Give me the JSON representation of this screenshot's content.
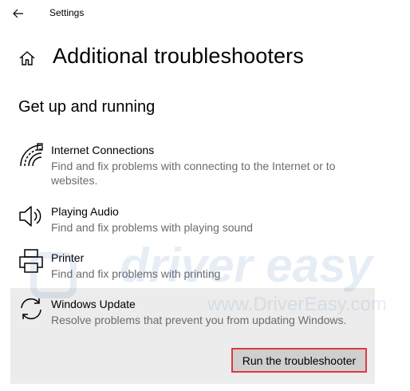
{
  "window": {
    "title": "Settings"
  },
  "page": {
    "title": "Additional troubleshooters",
    "section_title": "Get up and running"
  },
  "items": [
    {
      "icon": "wifi-icon",
      "name": "Internet Connections",
      "description": "Find and fix problems with connecting to the Internet or to websites."
    },
    {
      "icon": "speaker-icon",
      "name": "Playing Audio",
      "description": "Find and fix problems with playing sound"
    },
    {
      "icon": "printer-icon",
      "name": "Printer",
      "description": "Find and fix problems with printing"
    },
    {
      "icon": "update-icon",
      "name": "Windows Update",
      "description": "Resolve problems that prevent you from updating Windows."
    }
  ],
  "actions": {
    "run_label": "Run the troubleshooter"
  },
  "watermark": {
    "brand": "driver easy",
    "url": "www.DriverEasy.com"
  },
  "colors": {
    "highlight_border": "#e0383a",
    "selected_bg": "#ececec",
    "button_bg": "#cfcfcf"
  }
}
